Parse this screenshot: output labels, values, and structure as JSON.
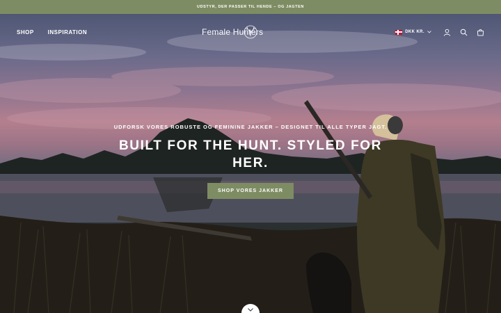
{
  "announcement": {
    "text": "UDSTYR, DER PASSER TIL HENDE – OG JAGTEN"
  },
  "header": {
    "nav_left": [
      {
        "label": "SHOP"
      },
      {
        "label": "INSPIRATION"
      }
    ],
    "logo_text": "Female Hunters",
    "currency": "DKK KR.",
    "icons": [
      "account-icon",
      "search-icon",
      "cart-icon"
    ]
  },
  "hero": {
    "eyebrow": "UDFORSK VORES ROBUSTE OG FEMININE JAKKER – DESIGNET TIL ALLE TYPER JAGT.",
    "headline": "BUILT FOR THE HUNT. STYLED FOR HER.",
    "cta_label": "SHOP VORES JAKKER"
  },
  "colors": {
    "brand_green": "#7e8c63",
    "text_light": "#ffffff"
  }
}
